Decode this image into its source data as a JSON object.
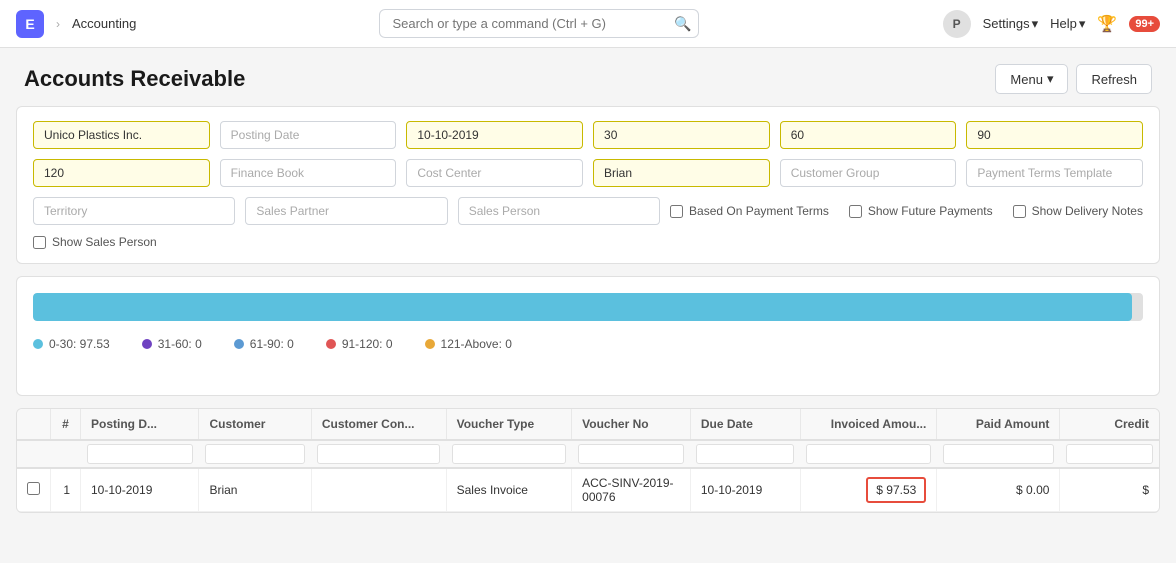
{
  "app": {
    "icon_label": "E",
    "breadcrumb": "Accounting",
    "search_placeholder": "Search or type a command (Ctrl + G)"
  },
  "nav": {
    "avatar_label": "P",
    "settings_label": "Settings",
    "help_label": "Help",
    "notification_count": "99+",
    "bell_unicode": "🏆"
  },
  "page": {
    "title": "Accounts Receivable",
    "menu_label": "Menu",
    "refresh_label": "Refresh"
  },
  "filters": {
    "company": "Unico Plastics Inc.",
    "posting_date_placeholder": "Posting Date",
    "posting_date_value": "10-10-2019",
    "field_30": "30",
    "field_60": "60",
    "field_90": "90",
    "field_120": "120",
    "finance_book_placeholder": "Finance Book",
    "cost_center_placeholder": "Cost Center",
    "customer_value": "Brian",
    "customer_group_placeholder": "Customer Group",
    "payment_terms_placeholder": "Payment Terms Template",
    "territory_placeholder": "Territory",
    "sales_partner_placeholder": "Sales Partner",
    "sales_person_placeholder": "Sales Person",
    "based_on_payment_label": "Based On Payment Terms",
    "show_future_payments_label": "Show Future Payments",
    "show_delivery_notes_label": "Show Delivery Notes",
    "show_sales_person_label": "Show Sales Person"
  },
  "chart": {
    "bar_percent": 99,
    "legend": [
      {
        "label": "0-30: 97.53",
        "color": "#5bc0de"
      },
      {
        "label": "31-60: 0",
        "color": "#6f42c1"
      },
      {
        "label": "61-90: 0",
        "color": "#5c9ad3"
      },
      {
        "label": "91-120: 0",
        "color": "#e05555"
      },
      {
        "label": "121-Above: 0",
        "color": "#e8a838"
      }
    ]
  },
  "table": {
    "columns": [
      {
        "key": "checkbox",
        "label": ""
      },
      {
        "key": "num",
        "label": "#"
      },
      {
        "key": "posting_date",
        "label": "Posting D..."
      },
      {
        "key": "customer",
        "label": "Customer"
      },
      {
        "key": "customer_contact",
        "label": "Customer Con..."
      },
      {
        "key": "voucher_type",
        "label": "Voucher Type"
      },
      {
        "key": "voucher_no",
        "label": "Voucher No"
      },
      {
        "key": "due_date",
        "label": "Due Date"
      },
      {
        "key": "invoiced_amount",
        "label": "Invoiced Amou..."
      },
      {
        "key": "paid_amount",
        "label": "Paid Amount"
      },
      {
        "key": "credit",
        "label": "Credit"
      }
    ],
    "rows": [
      {
        "num": "1",
        "posting_date": "10-10-2019",
        "customer": "Brian",
        "customer_contact": "",
        "voucher_type": "Sales Invoice",
        "voucher_no": "ACC-SINV-2019-00076",
        "due_date": "10-10-2019",
        "invoiced_amount": "$ 97.53",
        "paid_amount": "$ 0.00",
        "credit": "$",
        "invoiced_highlighted": true
      }
    ]
  }
}
